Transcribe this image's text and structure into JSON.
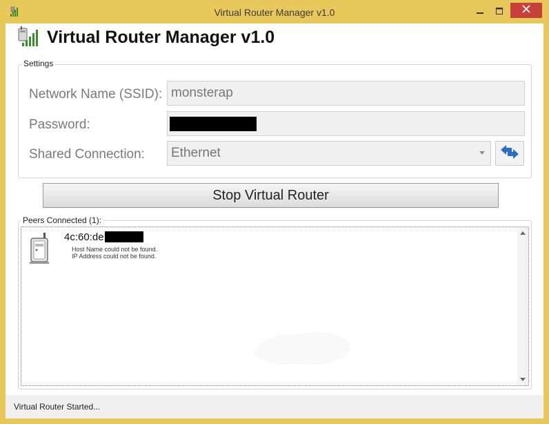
{
  "window": {
    "title": "Virtual Router Manager v1.0"
  },
  "app": {
    "title": "Virtual Router Manager v1.0"
  },
  "settings": {
    "legend": "Settings",
    "ssid_label": "Network Name (SSID):",
    "ssid_value": "monsterap",
    "password_label": "Password:",
    "shared_label": "Shared Connection:",
    "shared_value": "Ethernet"
  },
  "actions": {
    "stop_label": "Stop Virtual Router"
  },
  "peers": {
    "legend": "Peers Connected (1):",
    "items": [
      {
        "mac": "4c:60:de:",
        "host": "Host Name could not be found.",
        "ip": "IP Address could not be found."
      }
    ]
  },
  "status": {
    "text": "Virtual Router Started..."
  },
  "icons": {
    "app": "signal-bars-icon",
    "refresh": "refresh-icon",
    "peer": "device-icon"
  },
  "colors": {
    "frame": "#e8c85a",
    "close": "#c7403a"
  }
}
